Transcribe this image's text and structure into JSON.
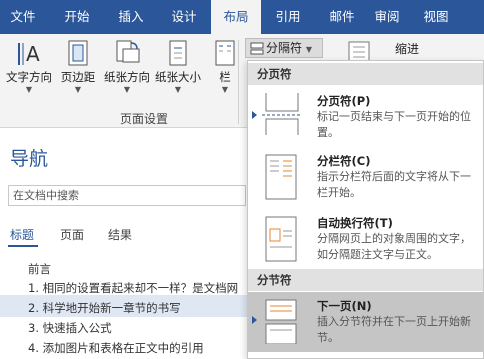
{
  "ribbon_tabs": [
    "文件",
    "开始",
    "插入",
    "设计",
    "布局",
    "引用",
    "邮件",
    "审阅",
    "视图"
  ],
  "active_tab": "布局",
  "ribbon": {
    "buttons": [
      "文字方向",
      "页边距",
      "纸张方向",
      "纸张大小",
      "栏"
    ],
    "group_label": "页面设置",
    "separator_button": "分隔符",
    "indent_label": "缩进"
  },
  "nav": {
    "title": "导航",
    "search_placeholder": "在文档中搜索",
    "tabs": [
      "标题",
      "页面",
      "结果"
    ],
    "items": [
      "前言",
      "1. 相同的设置看起来却不一样？是文档网",
      "2. 科学地开始新一章节的书写",
      "3. 快速插入公式",
      "4. 添加图片和表格在正文中的引用"
    ]
  },
  "dropdown": {
    "section_page": "分页符",
    "section_section": "分节符",
    "items": [
      {
        "title": "分页符(P)",
        "desc": "标记一页结束与下一页开始的位置。"
      },
      {
        "title": "分栏符(C)",
        "desc": "指示分栏符后面的文字将从下一栏开始。"
      },
      {
        "title": "自动换行符(T)",
        "desc": "分隔网页上的对象周围的文字，如分隔题注文字与正文。"
      },
      {
        "title": "下一页(N)",
        "desc": "插入分节符并在下一页上开始新节。"
      }
    ]
  },
  "colors": {
    "accent": "#2b579a",
    "highlight": "#c5c5c5",
    "orange": "#e8862e"
  }
}
